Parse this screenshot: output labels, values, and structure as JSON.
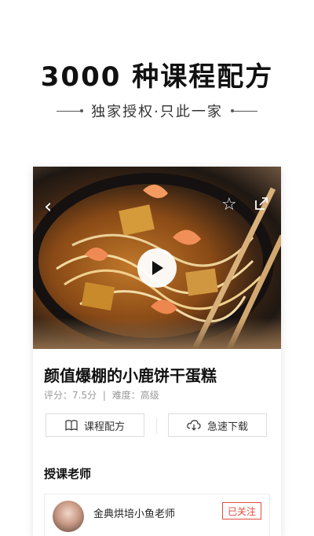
{
  "promo": {
    "headline": "3000 种课程配方",
    "subline": "独家授权·只此一家"
  },
  "recipe": {
    "title": "颜值爆棚的小鹿饼干蛋糕",
    "rating_label": "评分：7.5分",
    "separator": "|",
    "difficulty_label": "难度：高级",
    "actions": {
      "recipe_label": "课程配方",
      "download_label": "急速下载"
    }
  },
  "teacher": {
    "section_title": "授课老师",
    "name": "金典烘培小鱼老师",
    "follow_label": "已关注"
  },
  "icons": {
    "back": "chevron-left-icon",
    "favorite": "star-icon",
    "share": "share-icon",
    "play": "play-icon",
    "book": "book-icon",
    "download": "cloud-download-icon"
  },
  "colors": {
    "accent": "#e04c3c"
  }
}
